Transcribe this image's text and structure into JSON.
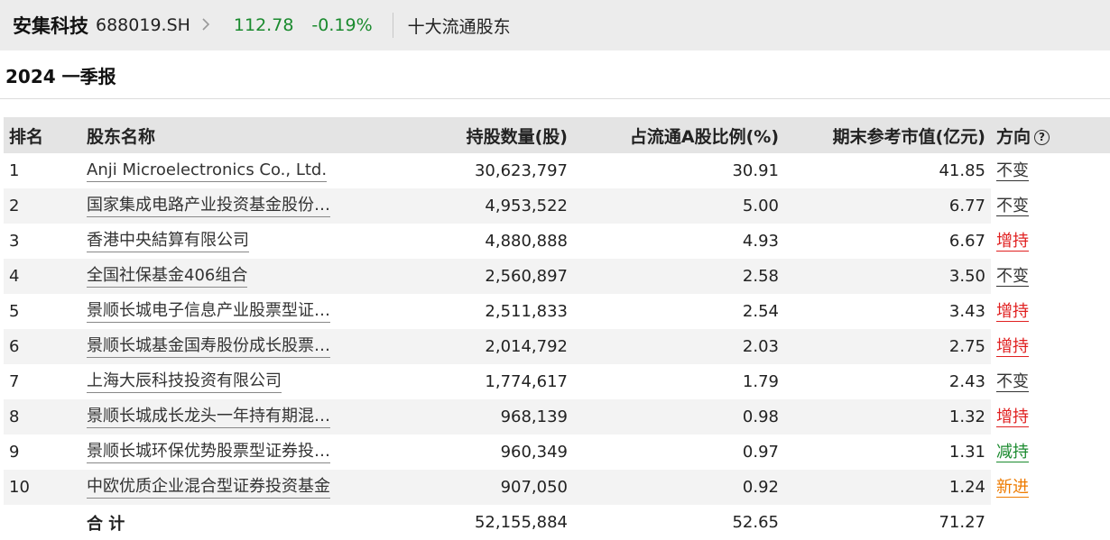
{
  "header": {
    "stock_name": "安集科技",
    "stock_code": "688019.SH",
    "price": "112.78",
    "change": "-0.19%",
    "section": "十大流通股东"
  },
  "report_title": "2024 一季报",
  "table": {
    "headers": {
      "rank": "排名",
      "holder": "股东名称",
      "shares": "持股数量(股)",
      "ratio": "占流通A股比例(%)",
      "value": "期末参考市值(亿元)",
      "direction": "方向"
    },
    "rows": [
      {
        "rank": "1",
        "name": "Anji Microelectronics Co., Ltd.",
        "shares": "30,623,797",
        "ratio": "30.91",
        "value": "41.85",
        "direction": "不变"
      },
      {
        "rank": "2",
        "name": "国家集成电路产业投资基金股份…",
        "shares": "4,953,522",
        "ratio": "5.00",
        "value": "6.77",
        "direction": "不变"
      },
      {
        "rank": "3",
        "name": "香港中央結算有限公司",
        "shares": "4,880,888",
        "ratio": "4.93",
        "value": "6.67",
        "direction": "增持"
      },
      {
        "rank": "4",
        "name": "全国社保基金406组合",
        "shares": "2,560,897",
        "ratio": "2.58",
        "value": "3.50",
        "direction": "不变"
      },
      {
        "rank": "5",
        "name": "景顺长城电子信息产业股票型证…",
        "shares": "2,511,833",
        "ratio": "2.54",
        "value": "3.43",
        "direction": "增持"
      },
      {
        "rank": "6",
        "name": "景顺长城基金国寿股份成长股票…",
        "shares": "2,014,792",
        "ratio": "2.03",
        "value": "2.75",
        "direction": "增持"
      },
      {
        "rank": "7",
        "name": "上海大辰科技投资有限公司",
        "shares": "1,774,617",
        "ratio": "1.79",
        "value": "2.43",
        "direction": "不变"
      },
      {
        "rank": "8",
        "name": "景顺长城成长龙头一年持有期混…",
        "shares": "968,139",
        "ratio": "0.98",
        "value": "1.32",
        "direction": "增持"
      },
      {
        "rank": "9",
        "name": "景顺长城环保优势股票型证券投…",
        "shares": "960,349",
        "ratio": "0.97",
        "value": "1.31",
        "direction": "减持"
      },
      {
        "rank": "10",
        "name": "中欧优质企业混合型证券投资基金",
        "shares": "907,050",
        "ratio": "0.92",
        "value": "1.24",
        "direction": "新进"
      }
    ],
    "total": {
      "label": "合 计",
      "shares": "52,155,884",
      "ratio": "52.65",
      "value": "71.27"
    }
  },
  "colors": {
    "up": "#1a8a2e",
    "unchanged": "#333333",
    "increase": "#e02020",
    "decrease": "#1a8a2e",
    "new": "#ee7b00"
  },
  "icons": {
    "chevron": "chevron-right-icon",
    "help": "question-circle-icon"
  }
}
